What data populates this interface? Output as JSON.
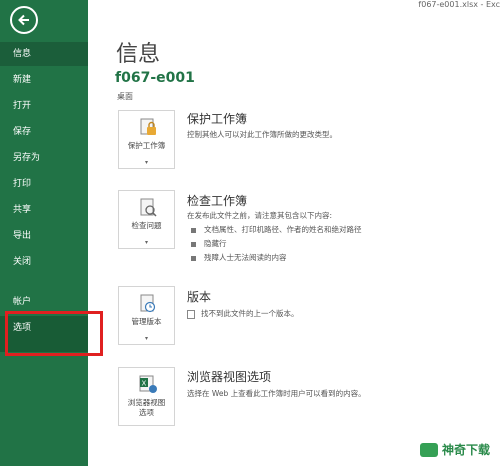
{
  "window": {
    "file_title": "f067-e001.xlsx - Exc"
  },
  "sidebar": {
    "items": [
      {
        "label": "信息"
      },
      {
        "label": "新建"
      },
      {
        "label": "打开"
      },
      {
        "label": "保存"
      },
      {
        "label": "另存为"
      },
      {
        "label": "打印"
      },
      {
        "label": "共享"
      },
      {
        "label": "导出"
      },
      {
        "label": "关闭"
      },
      {
        "label": "帐户"
      },
      {
        "label": "选项"
      }
    ],
    "active_index": 0,
    "highlight_index": 10
  },
  "main": {
    "page_title": "信息",
    "doc_name": "f067-e001",
    "doc_location": "桌面",
    "sections": [
      {
        "button_label": "保护工作簿",
        "title": "保护工作簿",
        "desc": "控制其他人可以对此工作簿所做的更改类型。"
      },
      {
        "button_label": "检查问题",
        "title": "检查工作簿",
        "desc": "在发布此文件之前，请注意其包含以下内容:",
        "bullets": [
          "文档属性、打印机路径、作者的姓名和绝对路径",
          "隐藏行",
          "残障人士无法阅读的内容"
        ]
      },
      {
        "button_label": "管理版本",
        "title": "版本",
        "desc": "找不到此文件的上一个版本。"
      },
      {
        "button_label_line1": "浏览器视图",
        "button_label_line2": "选项",
        "title": "浏览器视图选项",
        "desc": "选择在 Web 上查看此工作簿时用户可以看到的内容。"
      }
    ]
  },
  "watermark": {
    "text": "神奇下载"
  },
  "colors": {
    "sidebar": "#217346",
    "accent": "#217346",
    "highlight_border": "#e02020"
  }
}
